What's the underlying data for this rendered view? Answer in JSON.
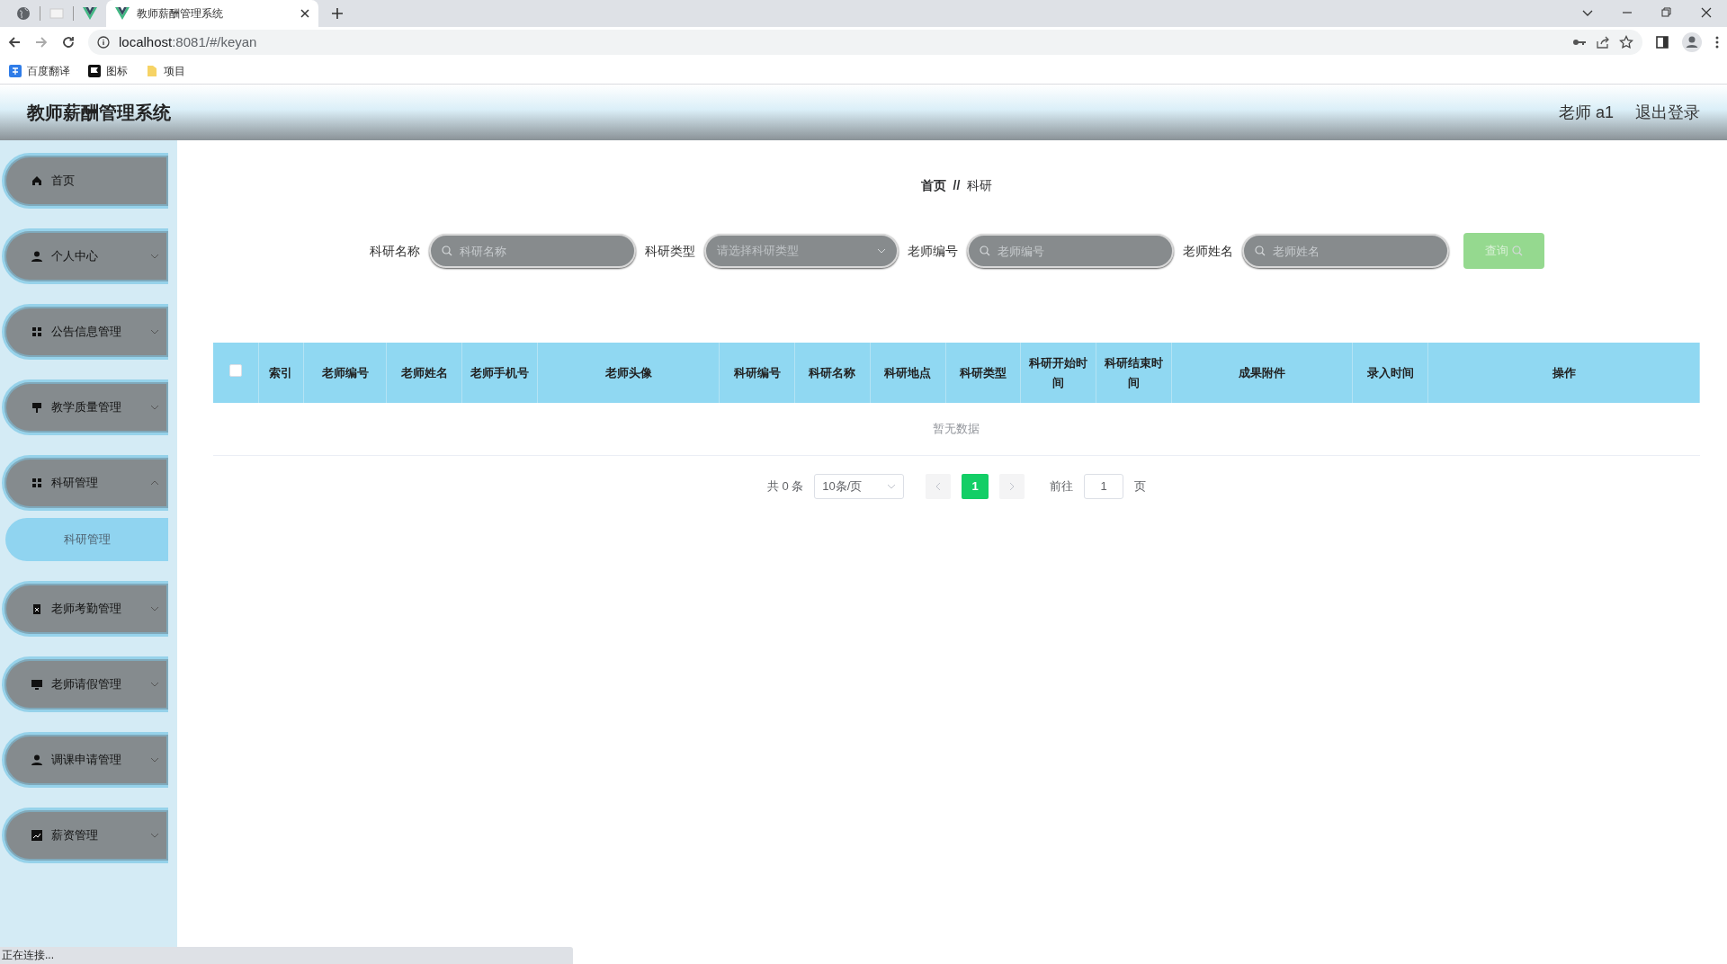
{
  "browser": {
    "tabs": [
      {
        "kind": "globe",
        "selected": false
      },
      {
        "kind": "blank",
        "selected": false
      },
      {
        "kind": "vue",
        "selected": false
      },
      {
        "kind": "vue",
        "title": "教师薪酬管理系统",
        "selected": true
      }
    ],
    "url_host": "localhost",
    "url_rest": ":8081/#/keyan",
    "bookmarks": [
      {
        "kind": "translate",
        "label": "百度翻译"
      },
      {
        "kind": "flag",
        "label": "图标"
      },
      {
        "kind": "folder",
        "label": "项目"
      }
    ],
    "status": "正在连接..."
  },
  "app": {
    "title": "教师薪酬管理系统",
    "user": "老师 a1",
    "logout": "退出登录",
    "sidebar": [
      {
        "label": "首页"
      },
      {
        "label": "个人中心",
        "expanded": false
      },
      {
        "label": "公告信息管理",
        "expanded": false
      },
      {
        "label": "教学质量管理",
        "expanded": false
      },
      {
        "label": "科研管理",
        "expanded": true,
        "children": [
          {
            "label": "科研管理",
            "selected": true
          }
        ]
      },
      {
        "label": "老师考勤管理",
        "expanded": false
      },
      {
        "label": "老师请假管理",
        "expanded": false
      },
      {
        "label": "调课申请管理",
        "expanded": false
      },
      {
        "label": "薪资管理",
        "expanded": false
      }
    ],
    "breadcrumb": [
      "首页",
      "科研"
    ],
    "breadcrumb_separator": "//",
    "search": [
      {
        "kind": "text",
        "label": "科研名称",
        "placeholder": "科研名称"
      },
      {
        "kind": "select",
        "label": "科研类型",
        "placeholder": "请选择科研类型"
      },
      {
        "kind": "text",
        "label": "老师编号",
        "placeholder": "老师编号"
      },
      {
        "kind": "text",
        "label": "老师姓名",
        "placeholder": "老师姓名"
      }
    ],
    "search_button": {
      "label": "查询",
      "disabled": true
    },
    "table": {
      "select_all": {
        "checked": false
      },
      "columns": [
        "索引",
        "老师编号",
        "老师姓名",
        "老师手机号",
        "老师头像",
        "科研编号",
        "科研名称",
        "科研地点",
        "科研类型",
        "科研开始时间",
        "科研结束时间",
        "成果附件",
        "录入时间",
        "操作"
      ],
      "empty_text": "暂无数据"
    },
    "pagination": {
      "total": "共 0 条",
      "page_size": "10条/页",
      "pages": [
        {
          "label": "1",
          "selected": true
        }
      ],
      "goto_label": "前往",
      "goto_value": "1",
      "goto_suffix": "页"
    }
  }
}
